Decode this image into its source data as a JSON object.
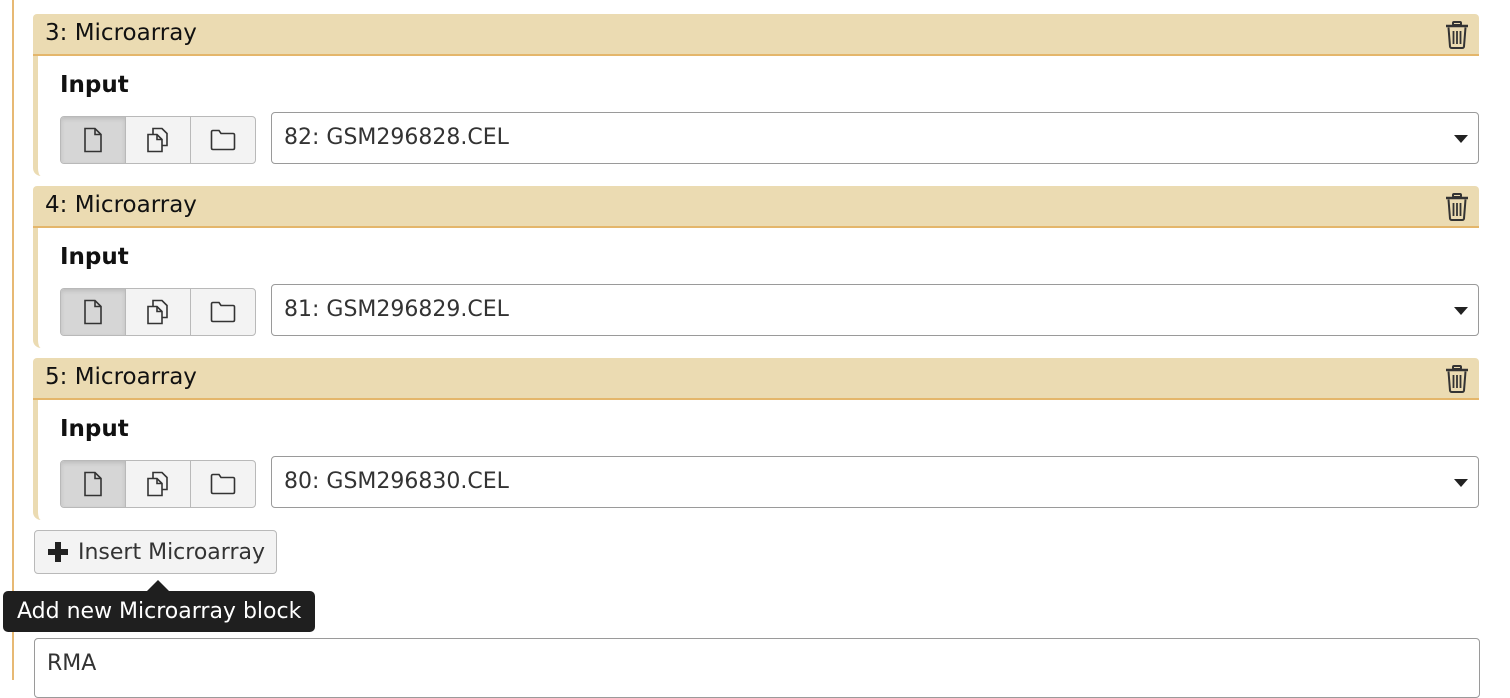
{
  "blocks": [
    {
      "title": "3: Microarray",
      "input_label": "Input",
      "selected_value": "82: GSM296828.CEL",
      "mode_buttons": [
        "single-dataset-icon",
        "multiple-datasets-icon",
        "dataset-collection-icon"
      ],
      "active_mode": "single-dataset-icon"
    },
    {
      "title": "4: Microarray",
      "input_label": "Input",
      "selected_value": "81: GSM296829.CEL",
      "mode_buttons": [
        "single-dataset-icon",
        "multiple-datasets-icon",
        "dataset-collection-icon"
      ],
      "active_mode": "single-dataset-icon"
    },
    {
      "title": "5: Microarray",
      "input_label": "Input",
      "selected_value": "80: GSM296830.CEL",
      "mode_buttons": [
        "single-dataset-icon",
        "multiple-datasets-icon",
        "dataset-collection-icon"
      ],
      "active_mode": "single-dataset-icon"
    }
  ],
  "insert_button": {
    "label": "Insert Microarray",
    "icon": "plus-icon"
  },
  "tooltip": {
    "text": "Add new Microarray block"
  },
  "next_field": {
    "value": "RMA"
  },
  "colors": {
    "header_bg": "#ebdbb2",
    "header_border": "#e4b66b",
    "outer_border": "#e7b974",
    "tooltip_bg": "#1f1f1f"
  }
}
